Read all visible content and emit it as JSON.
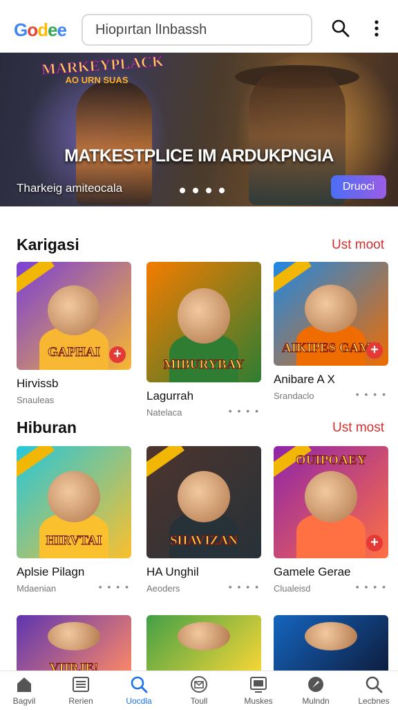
{
  "header": {
    "logo_letters": [
      "G",
      "o",
      "d",
      "e",
      "e"
    ],
    "search_text": "Hiopırtan lInbassh"
  },
  "hero": {
    "badge_line1": "MARKEYPLACK",
    "badge_line2": "AO URN SUAS",
    "title": "MATKESTPLICE IM ARDUKPNGIA",
    "subtitle": "Tharkeig amiteocala",
    "button_label": "Druoci",
    "slides": 4,
    "colors": {
      "button_start": "#4a6ef5",
      "button_end": "#9b5de5"
    }
  },
  "sections": [
    {
      "title": "Karigasi",
      "see_all": "Ust moot",
      "cards": [
        {
          "art_text": "GAPHAI",
          "name": "Hirvissb",
          "sub": "Snauleas",
          "more": "",
          "colors": [
            "#7a3fd6",
            "#f7b733"
          ]
        },
        {
          "art_text": "MIBURYBAY",
          "name": "Lagurrah",
          "sub": "Natelaca",
          "more": "• • • •",
          "colors": [
            "#f57c00",
            "#2e7d32"
          ]
        },
        {
          "art_text": "AIKIPES GAME",
          "name": "Anibare A X",
          "sub": "Srandaclo",
          "more": "• • • •",
          "colors": [
            "#1e88e5",
            "#ef6c00"
          ]
        }
      ]
    },
    {
      "title": "Hiburan",
      "see_all": "Ust most",
      "cards": [
        {
          "art_text": "HIRVTAI",
          "name": "Aplsie Pilagn",
          "sub": "Mdaenian",
          "more": "• • • •",
          "colors": [
            "#26c6da",
            "#fbc02d"
          ]
        },
        {
          "art_text": "SHAVIZAN",
          "name": "HA Unghil",
          "sub": "Aeoders",
          "more": "• • • •",
          "colors": [
            "#4e342e",
            "#263238"
          ]
        },
        {
          "art_text": "OUIPOAEY",
          "name": "Gamele Gerae",
          "sub": "Clualeisd",
          "more": "• • • •",
          "colors": [
            "#8e24aa",
            "#ff7043"
          ]
        }
      ]
    },
    {
      "cards": [
        {
          "art_text": "VIIRJE!",
          "colors": [
            "#5e35b1",
            "#ff8a65"
          ]
        },
        {
          "art_text": "",
          "colors": [
            "#43a047",
            "#fdd835"
          ]
        },
        {
          "art_text": "",
          "colors": [
            "#1565c0",
            "#0d1b3a"
          ]
        }
      ]
    }
  ],
  "bottom_nav": [
    {
      "label": "Bagvil",
      "icon": "home-icon",
      "active": false
    },
    {
      "label": "Rerien",
      "icon": "list-icon",
      "active": false
    },
    {
      "label": "Uocdla",
      "icon": "search-icon",
      "active": true
    },
    {
      "label": "Toull",
      "icon": "mail-icon",
      "active": false
    },
    {
      "label": "Muskes",
      "icon": "tv-icon",
      "active": false
    },
    {
      "label": "Mulndn",
      "icon": "compass-icon",
      "active": false
    },
    {
      "label": "Lecbnes",
      "icon": "search-icon",
      "active": false
    }
  ],
  "accent": "#1a73e8",
  "link_color": "#d32f2f"
}
